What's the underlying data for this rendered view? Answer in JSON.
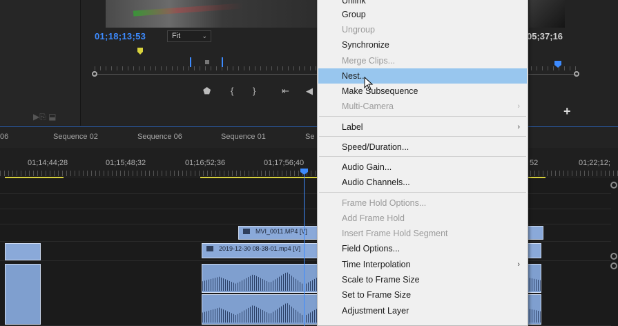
{
  "monitor": {
    "timecode_left": "01;18;13;53",
    "timecode_right": "05;37;16",
    "fit_value": "Fit"
  },
  "timeline": {
    "tabs": [
      "06",
      "Sequence 02",
      "Sequence 06",
      "Sequence 01",
      "Se"
    ],
    "ruler": [
      "01;14;44;28",
      "01;15;48;32",
      "01;16;52;36",
      "01;17;56;40",
      "52",
      "01;22;12;"
    ],
    "clips": {
      "v2": "MVI_0011.MP4 [V]",
      "v1": "2019-12-30 08-38-01.mp4 [V]"
    }
  },
  "menu": {
    "items": [
      {
        "label": "Unlink",
        "disabled": false
      },
      {
        "label": "Group",
        "disabled": false
      },
      {
        "label": "Ungroup",
        "disabled": true
      },
      {
        "label": "Synchronize",
        "disabled": false
      },
      {
        "label": "Merge Clips...",
        "disabled": true
      },
      {
        "label": "Nest...",
        "disabled": false,
        "hover": true
      },
      {
        "label": "Make Subsequence",
        "disabled": false
      },
      {
        "label": "Multi-Camera",
        "disabled": true,
        "submenu": true
      },
      {
        "label": "Label",
        "disabled": false,
        "submenu": true
      },
      {
        "label": "Speed/Duration...",
        "disabled": false
      },
      {
        "label": "Audio Gain...",
        "disabled": false
      },
      {
        "label": "Audio Channels...",
        "disabled": false
      },
      {
        "label": "Frame Hold Options...",
        "disabled": true
      },
      {
        "label": "Add Frame Hold",
        "disabled": true
      },
      {
        "label": "Insert Frame Hold Segment",
        "disabled": true
      },
      {
        "label": "Field Options...",
        "disabled": false
      },
      {
        "label": "Time Interpolation",
        "disabled": false,
        "submenu": true
      },
      {
        "label": "Scale to Frame Size",
        "disabled": false
      },
      {
        "label": "Set to Frame Size",
        "disabled": false
      },
      {
        "label": "Adjustment Layer",
        "disabled": false
      }
    ]
  },
  "icons": {
    "marker": "marker-icon",
    "mark_in": "mark-in-icon",
    "mark_out": "mark-out-icon",
    "go_to_in": "go-to-in-icon",
    "step_back": "step-back-icon",
    "add": "plus-icon",
    "submenu": "chevron-right-icon",
    "cursor": "mouse-pointer-icon"
  },
  "colors": {
    "accent": "#3d8bff",
    "work_area": "#d8d23c",
    "menu_hover": "#98c6ee",
    "clip": "#8aa9d9"
  }
}
